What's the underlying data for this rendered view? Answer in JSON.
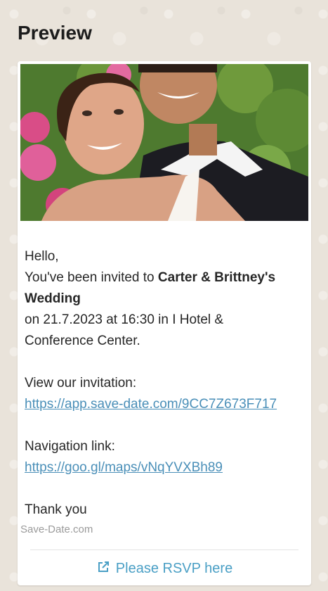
{
  "preview": {
    "title": "Preview"
  },
  "image": {
    "name": "wedding-couple-photo"
  },
  "message": {
    "greeting": "Hello,",
    "invite_prefix": "You've been invited to ",
    "event_name_part1": "Carter & Brittney's",
    "event_name_part2": "Wedding",
    "date_line_1": "on 21.7.2023 at 16:30 in I Hotel &",
    "date_line_2": "Conference Center.",
    "view_label": "View our invitation:",
    "invitation_link": "https://app.save-date.com/9CC7Z673F717",
    "navigation_label": "Navigation link:",
    "navigation_link": "https://goo.gl/maps/vNqYVXBh89",
    "closing": "Thank you"
  },
  "footer": {
    "brand": "Save-Date.com",
    "rsvp_label": "Please RSVP here",
    "rsvp_icon": "external-link-icon"
  },
  "colors": {
    "link": "#4a8fb8",
    "rsvp": "#4a9fc5",
    "background": "#e9e3da"
  }
}
